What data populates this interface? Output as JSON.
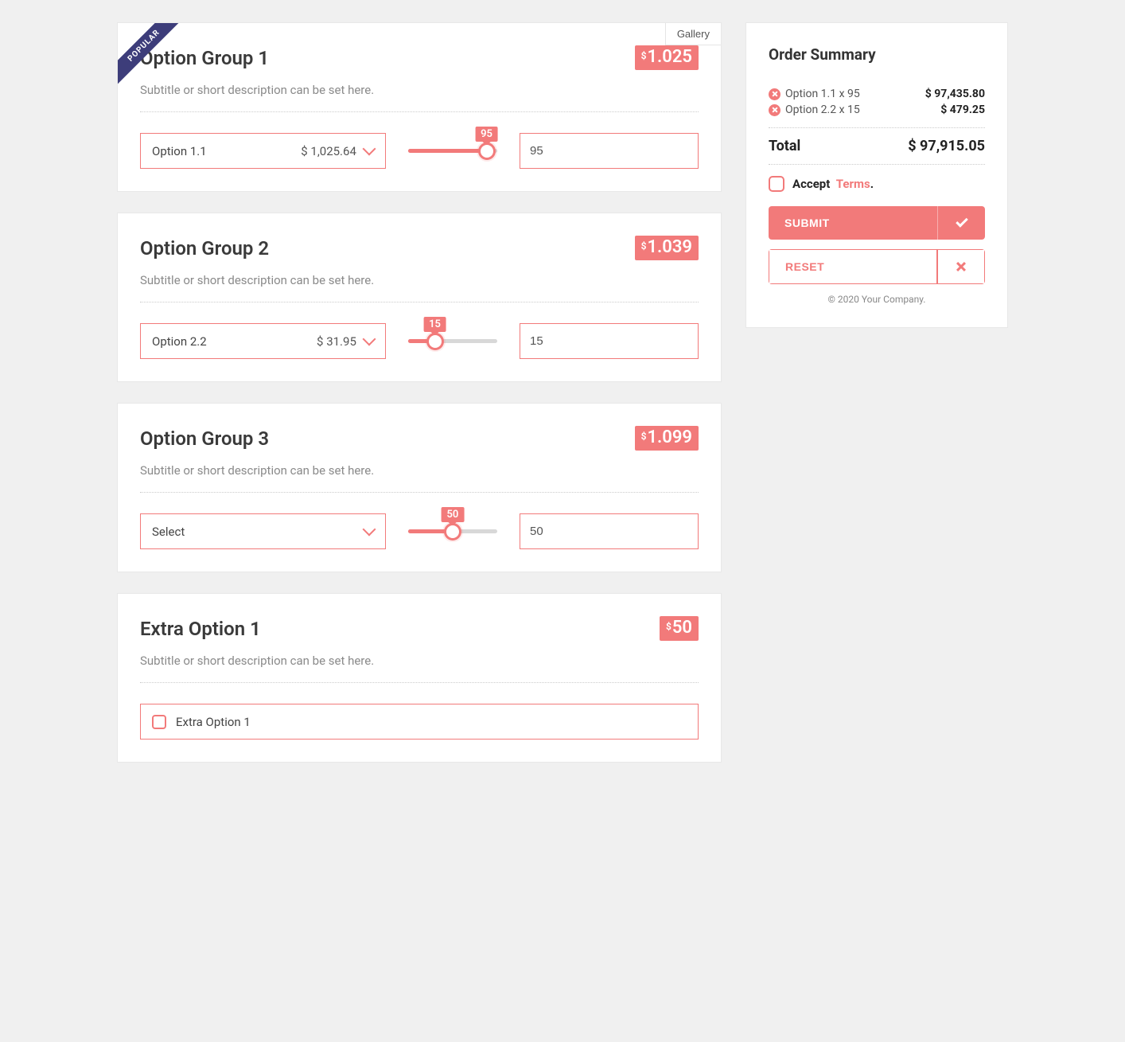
{
  "popular_label": "POPULAR",
  "gallery_label": "Gallery",
  "groups": [
    {
      "title": "Option Group 1",
      "price": "1.025",
      "subtitle": "Subtitle or short description can be set here.",
      "select_label": "Option 1.1",
      "select_price": "$ 1,025.64",
      "slider_value": "95",
      "slider_pct": 88,
      "qty": "95",
      "has_popular": true,
      "has_gallery": true,
      "type": "slider"
    },
    {
      "title": "Option Group 2",
      "price": "1.039",
      "subtitle": "Subtitle or short description can be set here.",
      "select_label": "Option 2.2",
      "select_price": "$ 31.95",
      "slider_value": "15",
      "slider_pct": 30,
      "qty": "15",
      "type": "slider"
    },
    {
      "title": "Option Group 3",
      "price": "1.099",
      "subtitle": "Subtitle or short description can be set here.",
      "select_label": "Select",
      "select_price": "",
      "slider_value": "50",
      "slider_pct": 50,
      "qty": "50",
      "type": "slider"
    },
    {
      "title": "Extra Option 1",
      "price": "50",
      "subtitle": "Subtitle or short description can be set here.",
      "check_label": "Extra Option 1",
      "type": "check"
    }
  ],
  "summary": {
    "title": "Order Summary",
    "items": [
      {
        "label": "Option 1.1 x 95",
        "amount": "$ 97,435.80"
      },
      {
        "label": "Option 2.2 x 15",
        "amount": "$ 479.25"
      }
    ],
    "total_label": "Total",
    "total_amount": "$ 97,915.05",
    "accept_label": "Accept",
    "terms_label": "Terms",
    "terms_period": ".",
    "submit_label": "SUBMIT",
    "reset_label": "RESET",
    "copyright": "© 2020 Your Company."
  }
}
